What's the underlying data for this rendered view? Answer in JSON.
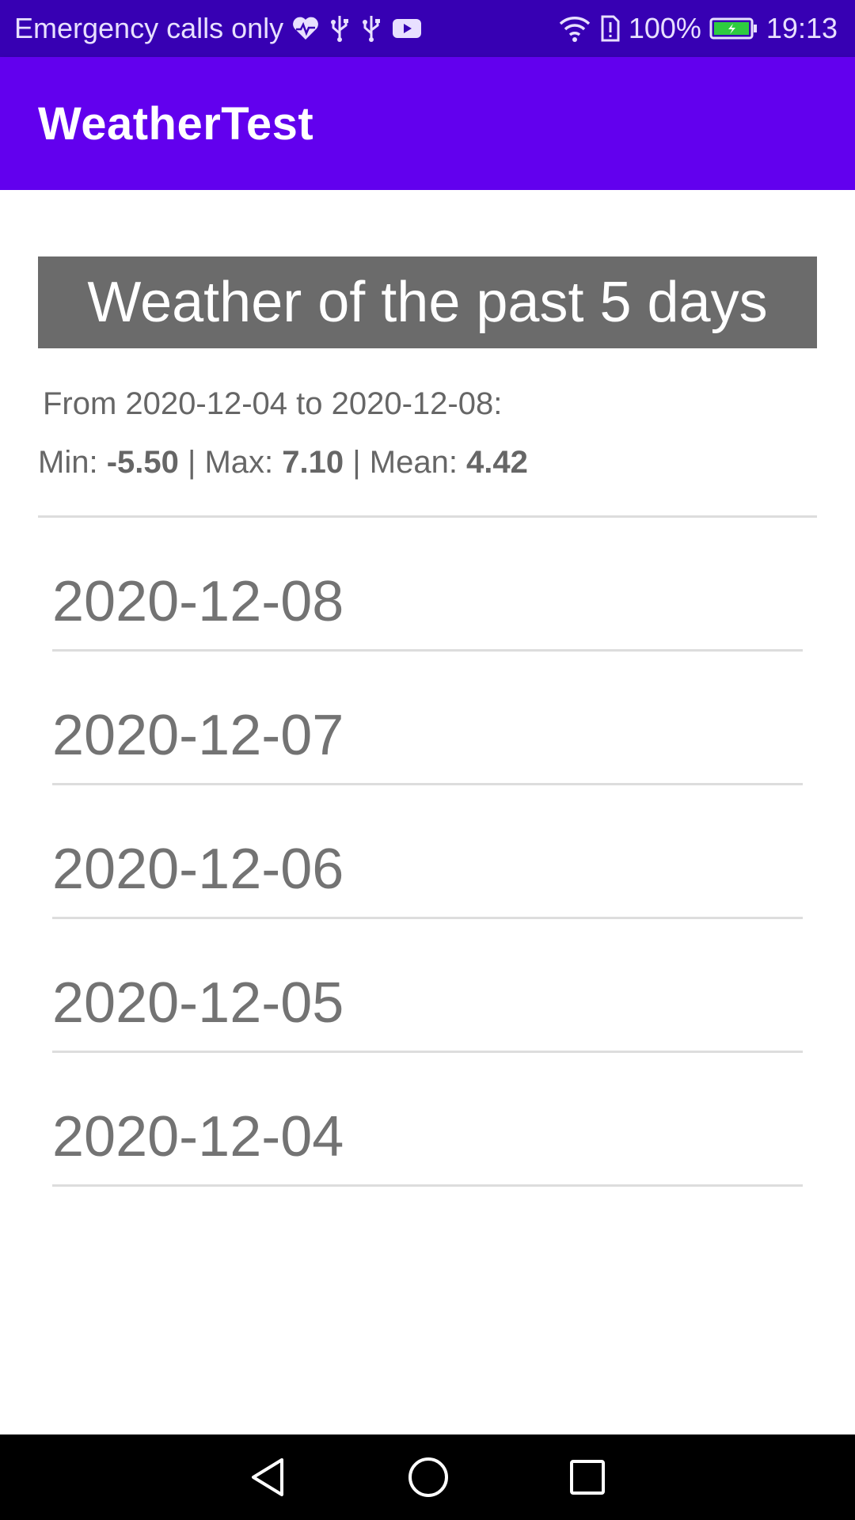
{
  "status_bar": {
    "carrier_text": "Emergency calls only",
    "battery_percent": "100%",
    "time": "19:13",
    "battery_color": "#2ecc40",
    "icons_left": [
      "heart-rate-icon",
      "usb-icon",
      "usb-icon",
      "youtube-icon"
    ],
    "icons_right": [
      "wifi-icon",
      "sim-alert-icon",
      "battery-icon"
    ]
  },
  "app_bar": {
    "title": "WeatherTest",
    "color": "#6200ee"
  },
  "summary": {
    "header": "Weather of the past 5 days",
    "range_text": "From 2020-12-04 to 2020-12-08:",
    "min_label": "Min: ",
    "min_value": "-5.50",
    "max_label": " | Max: ",
    "max_value": "7.10",
    "mean_label": " | Mean: ",
    "mean_value": "4.42"
  },
  "days": [
    {
      "date": "2020-12-08"
    },
    {
      "date": "2020-12-07"
    },
    {
      "date": "2020-12-06"
    },
    {
      "date": "2020-12-05"
    },
    {
      "date": "2020-12-04"
    }
  ],
  "nav_bar": {
    "buttons": [
      "back-icon",
      "home-icon",
      "recents-icon"
    ]
  }
}
